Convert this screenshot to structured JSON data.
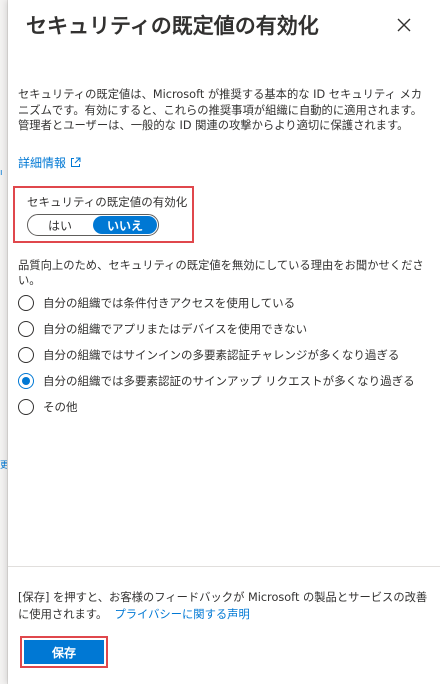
{
  "background": {
    "marks": [
      "ı",
      "更"
    ]
  },
  "panel": {
    "title": "セキュリティの既定値の有効化",
    "close_icon": "close-icon",
    "description": "セキュリティの既定値は、Microsoft が推奨する基本的な ID セキュリティ メカニズムです。有効にすると、これらの推奨事項が組織に自動的に適用されます。管理者とユーザーは、一般的な ID 関連の攻撃からより適切に保護されます。",
    "more_info_link": "詳細情報",
    "enable": {
      "label": "セキュリティの既定値の有効化",
      "options": [
        "はい",
        "いいえ"
      ],
      "selected": "いいえ"
    },
    "reason_prompt": "品質向上のため、セキュリティの既定値を無効にしている理由をお聞かせください。",
    "reasons": [
      {
        "label": "自分の組織では条件付きアクセスを使用している",
        "checked": false
      },
      {
        "label": "自分の組織でアプリまたはデバイスを使用できない",
        "checked": false
      },
      {
        "label": "自分の組織ではサインインの多要素認証チャレンジが多くなり過ぎる",
        "checked": false
      },
      {
        "label": "自分の組織では多要素認証のサインアップ リクエストが多くなり過ぎる",
        "checked": true
      },
      {
        "label": "その他",
        "checked": false
      }
    ]
  },
  "footer": {
    "text": "[保存] を押すと、お客様のフィードバックが Microsoft の製品とサービスの改善に使用されます。",
    "privacy_link": "プライバシーに関する声明",
    "save_label": "保存"
  },
  "colors": {
    "accent": "#0078d4",
    "highlight": "#e0474c"
  }
}
